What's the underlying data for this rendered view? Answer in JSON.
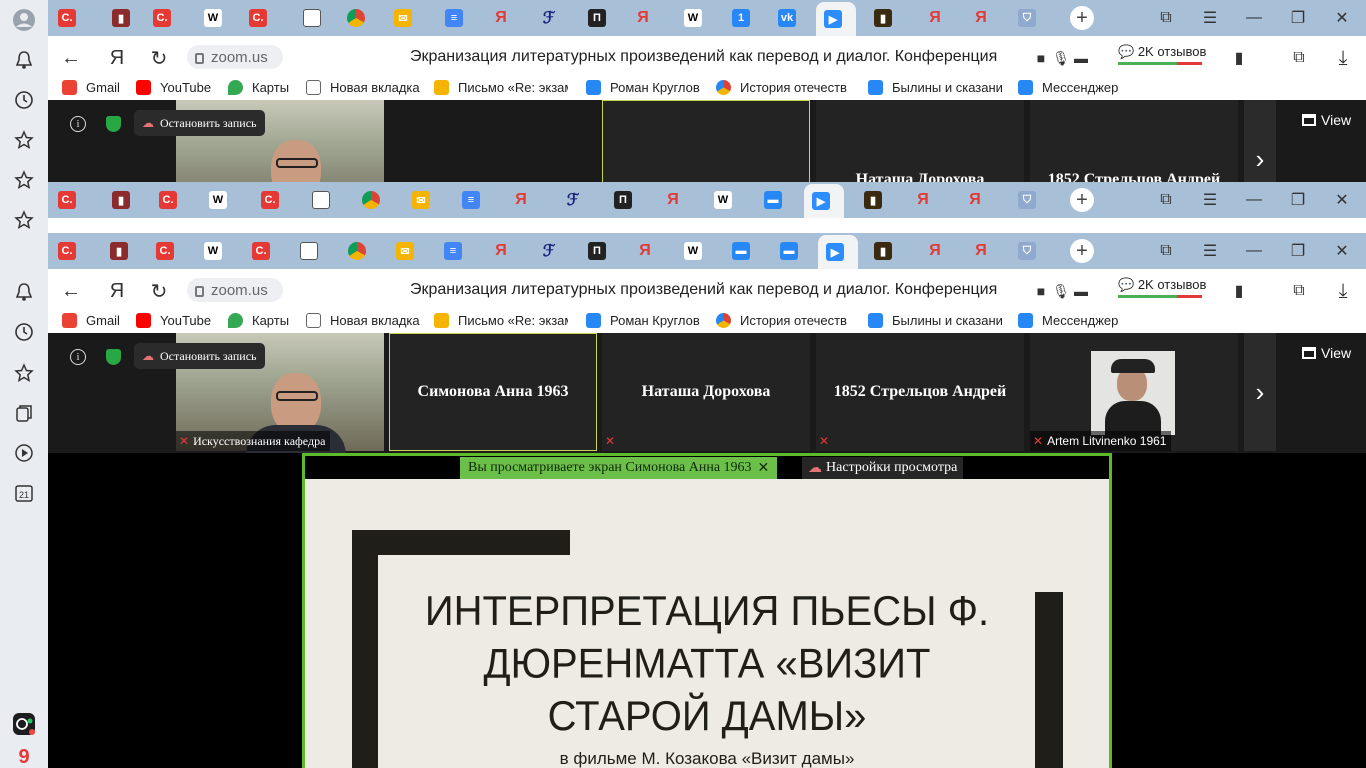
{
  "browser": {
    "url": "zoom.us",
    "page_title": "Экранизация литературных произведений как перевод и диалог. Конференция",
    "reviews": "2K отзывов",
    "tab_badge": "1",
    "bookmarks": [
      {
        "label": "Gmail",
        "icon": "gmail-icon",
        "color": "#ea4335"
      },
      {
        "label": "YouTube",
        "icon": "youtube-icon",
        "color": "#ff0000"
      },
      {
        "label": "Карты",
        "icon": "maps-pin-icon",
        "color": "#34a853"
      },
      {
        "label": "Новая вкладка",
        "icon": "page-icon",
        "color": "#ffffff"
      },
      {
        "label": "Письмо «Re: экзам",
        "icon": "mail-icon",
        "color": "#f4b400"
      },
      {
        "label": "Роман Круглов",
        "icon": "vk-icon",
        "color": "#2787f5"
      },
      {
        "label": "История отечеств",
        "icon": "chrome-like-icon",
        "color": "#db4437"
      },
      {
        "label": "Былины и сказани",
        "icon": "messenger-icon",
        "color": "#2787f5"
      },
      {
        "label": "Мессенджер",
        "icon": "vk-icon",
        "color": "#2787f5"
      }
    ]
  },
  "zoom": {
    "record_label": "Остановить запись",
    "view_label": "View",
    "participants": [
      {
        "name": "Искусствознания кафедра",
        "kind": "video"
      },
      {
        "name": "Симонова Анна 1963",
        "kind": "name"
      },
      {
        "name": "Наташа Дорохова",
        "kind": "name"
      },
      {
        "name": "1852 Стрельцов Андрей",
        "kind": "name"
      },
      {
        "name": "Artem Litvinenko 1961",
        "kind": "video"
      }
    ],
    "share_banner": "Вы просматриваете экран Симонова Анна 1963",
    "view_settings": "Настройки просмотра"
  },
  "slide": {
    "title": "ИНТЕРПРЕТАЦИЯ ПЬЕСЫ Ф. ДЮРЕНМАТТА «ВИЗИТ СТАРОЙ ДАМЫ»",
    "subtitle": "в фильме М. Козакова «Визит дамы»"
  }
}
